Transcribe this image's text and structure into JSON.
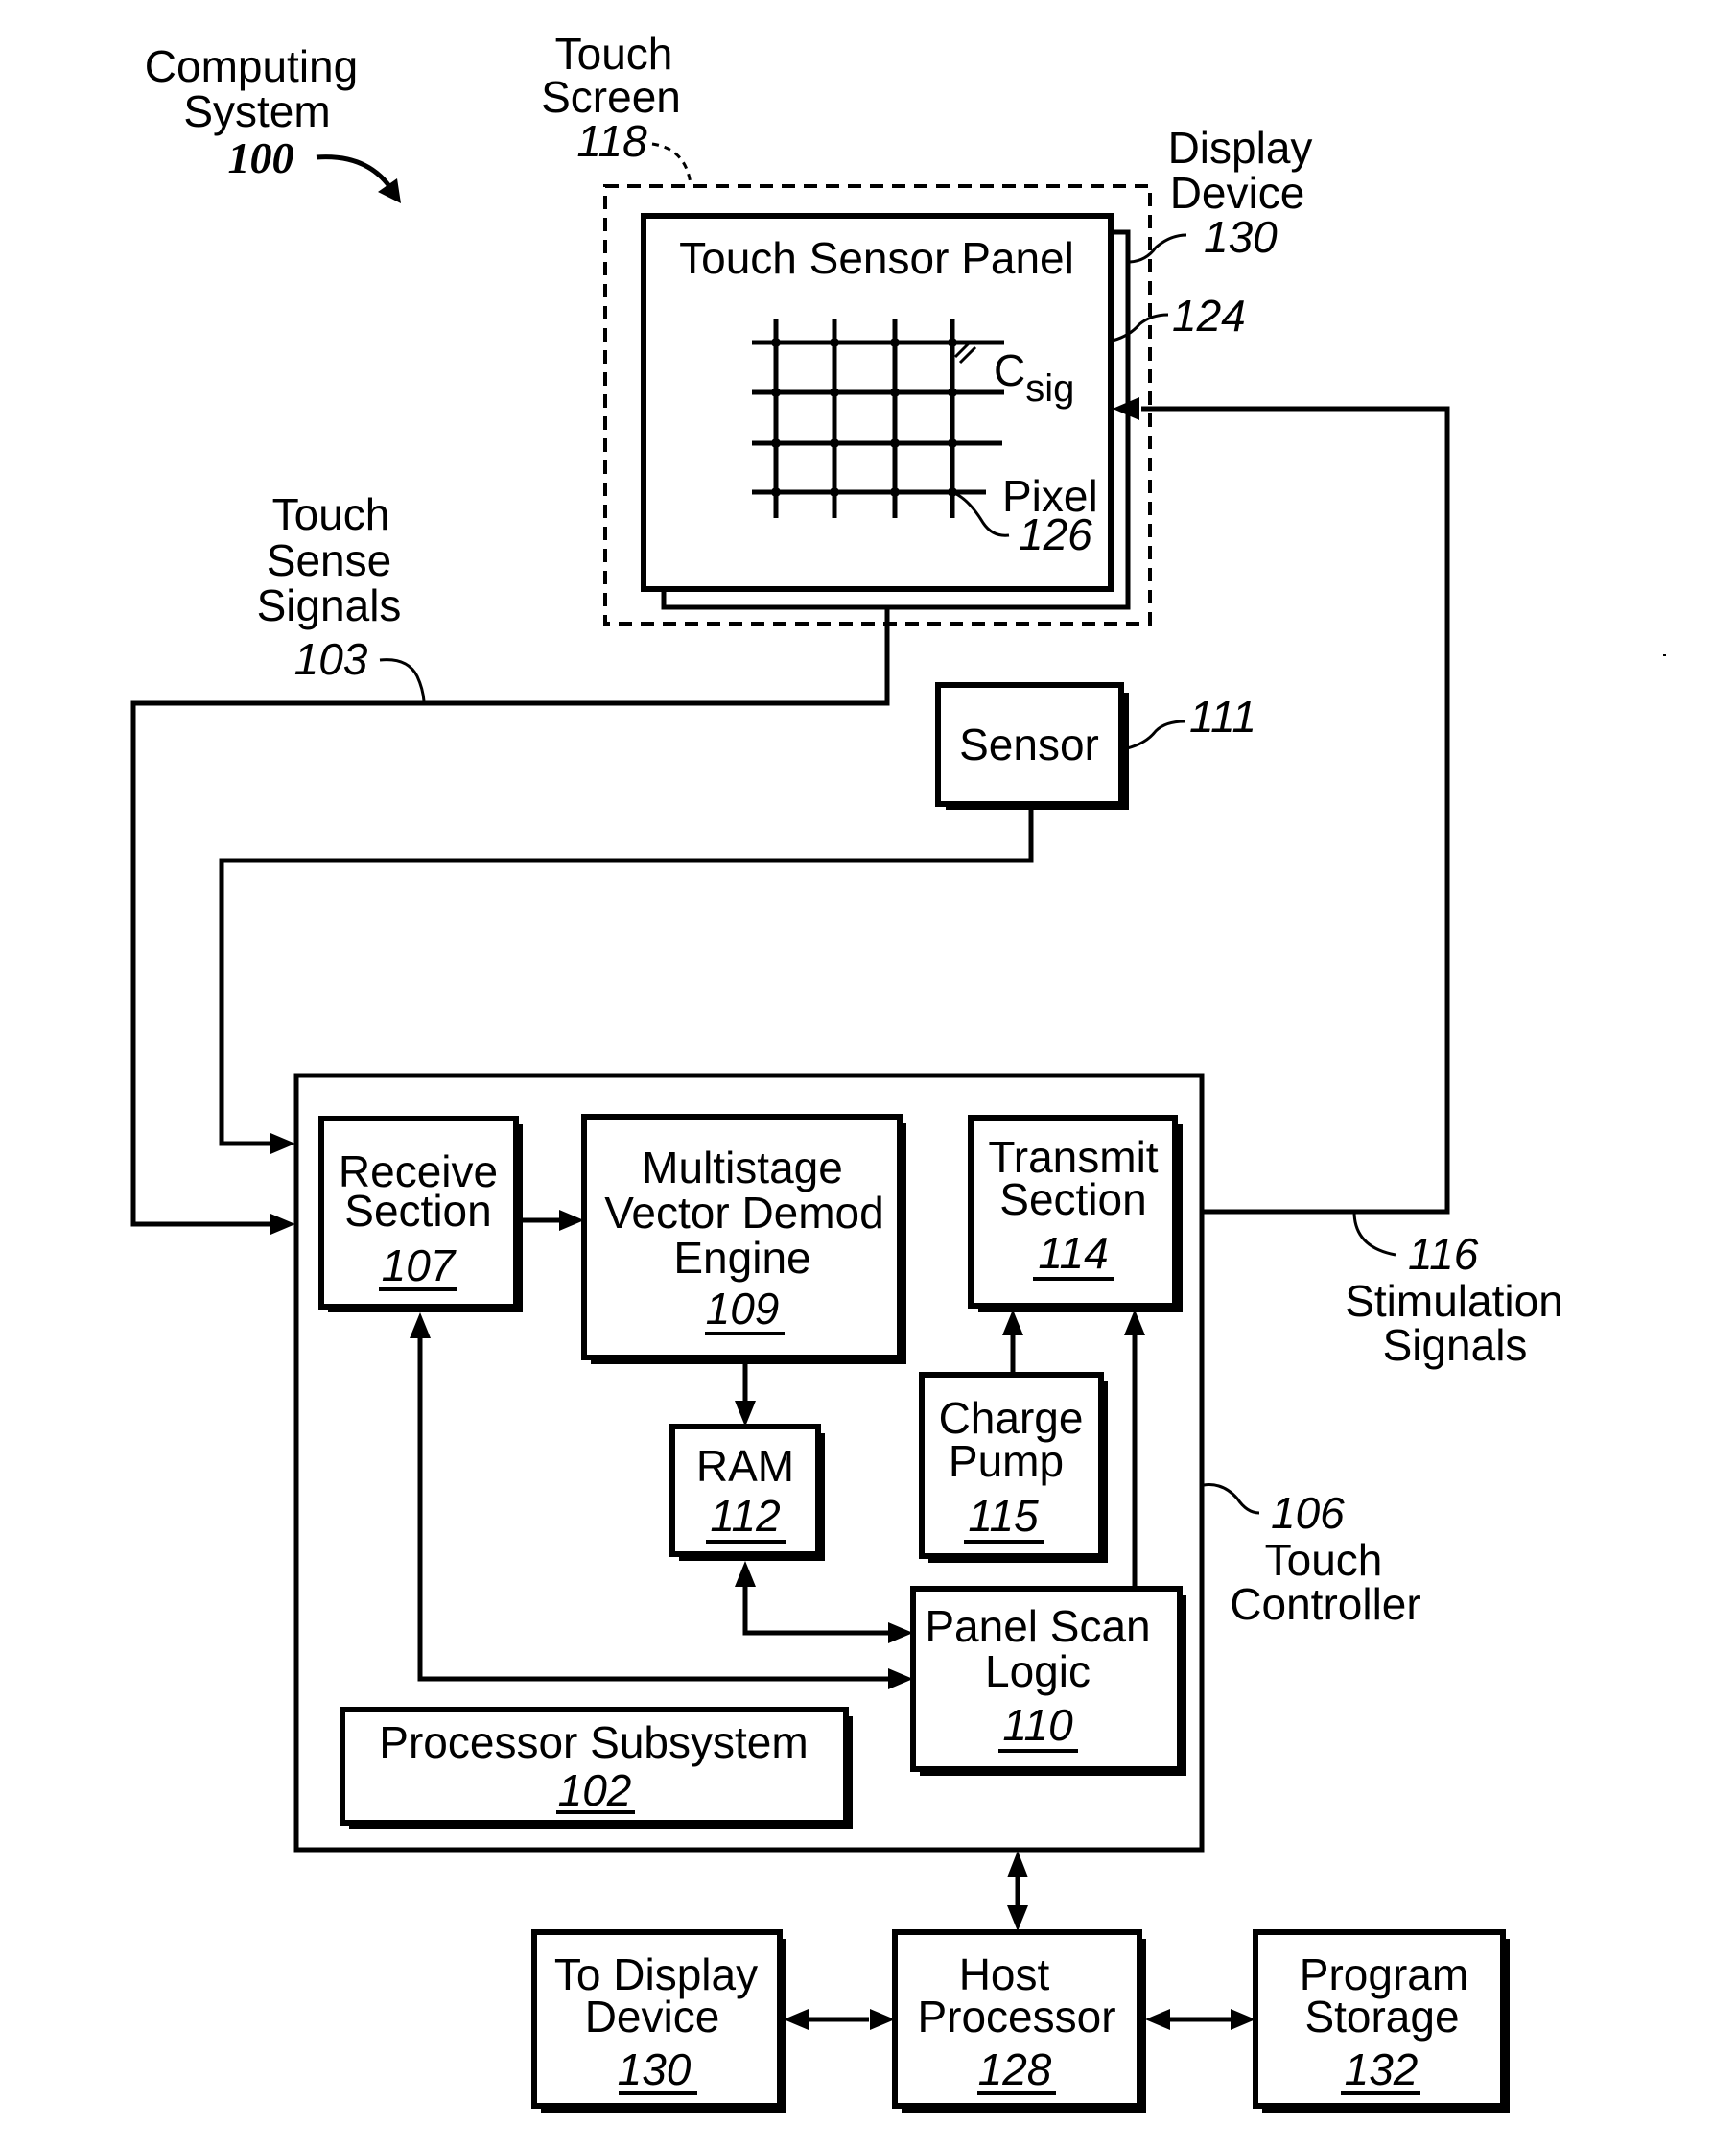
{
  "figure": {
    "title": "Computing System",
    "system_label": {
      "line1": "Computing",
      "line2": "System",
      "ref": "100"
    },
    "touch_screen_label": {
      "line1": "Touch",
      "line2": "Screen",
      "ref": "118"
    },
    "display_device_label": {
      "line1": "Display",
      "line2": "Device",
      "ref": "130"
    },
    "panel_ref": "124",
    "touch_sensor_panel": {
      "title": "Touch Sensor Panel",
      "csig_main": "C",
      "csig_sub": "sig",
      "pixel_label": "Pixel",
      "pixel_ref": "126"
    },
    "touch_sense_signals": {
      "line1": "Touch",
      "line2": "Sense",
      "line3": "Signals",
      "ref": "103"
    },
    "sensor": {
      "label": "Sensor",
      "ref": "111"
    },
    "stimulation_signals": {
      "ref": "116",
      "line1": "Stimulation",
      "line2": "Signals"
    },
    "touch_controller": {
      "ref": "106",
      "line1": "Touch",
      "line2": "Controller"
    },
    "blocks": {
      "receive": {
        "line1": "Receive",
        "line2": "Section",
        "ref": "107"
      },
      "demod": {
        "line1": "Multistage",
        "line2": "Vector Demod",
        "line3": "Engine",
        "ref": "109"
      },
      "transmit": {
        "line1": "Transmit",
        "line2": "Section",
        "ref": "114"
      },
      "ram": {
        "line1": "RAM",
        "ref": "112"
      },
      "charge_pump": {
        "line1": "Charge",
        "line2": "Pump",
        "ref": "115"
      },
      "panel_scan": {
        "line1": "Panel Scan",
        "line2": "Logic",
        "ref": "110"
      },
      "processor": {
        "line1": "Processor Subsystem",
        "ref": "102"
      },
      "to_display": {
        "line1": "To Display",
        "line2": "Device",
        "ref": "130"
      },
      "host": {
        "line1": "Host",
        "line2": "Processor",
        "ref": "128"
      },
      "program": {
        "line1": "Program",
        "line2": "Storage",
        "ref": "132"
      }
    }
  }
}
